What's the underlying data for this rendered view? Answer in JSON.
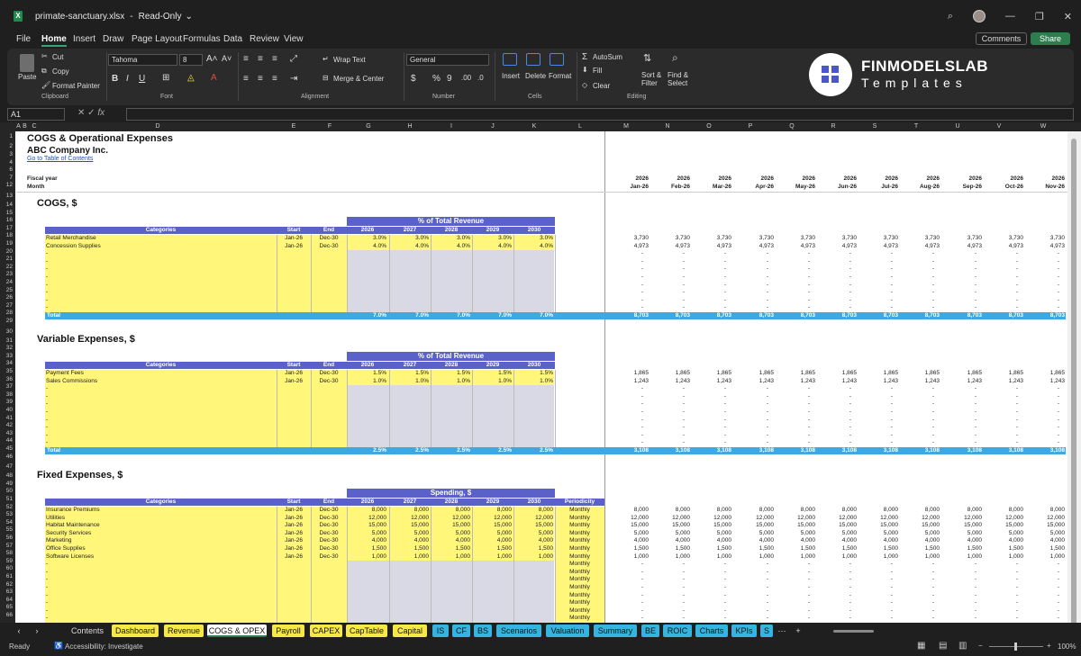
{
  "window": {
    "filename": "primate-sanctuary.xlsx",
    "mode": "Read-Only"
  },
  "menu": [
    "File",
    "Home",
    "Insert",
    "Draw",
    "Page Layout",
    "Formulas",
    "Data",
    "Review",
    "View"
  ],
  "menu_active": "Home",
  "top_buttons": {
    "comments": "Comments",
    "share": "Share"
  },
  "ribbon": {
    "clipboard": {
      "paste": "Paste",
      "cut": "Cut",
      "copy": "Copy",
      "format_painter": "Format Painter",
      "group": "Clipboard"
    },
    "font": {
      "name": "Tahoma",
      "size": "8",
      "group": "Font"
    },
    "alignment": {
      "wrap": "Wrap Text",
      "merge": "Merge & Center",
      "group": "Alignment"
    },
    "number": {
      "format": "General",
      "group": "Number"
    },
    "cells": {
      "insert": "Insert",
      "delete": "Delete",
      "format": "Format",
      "group": "Cells"
    },
    "editing": {
      "autosum": "AutoSum",
      "fill": "Fill",
      "clear": "Clear",
      "sort": "Sort &",
      "sort2": "Filter",
      "find": "Find &",
      "find2": "Select",
      "group": "Editing"
    },
    "brand": {
      "name": "FINMODELSLAB",
      "sub": "Templates"
    }
  },
  "formula_bar": {
    "name_box": "A1",
    "fx": "fx"
  },
  "col_headers": [
    "A",
    "B",
    "C",
    "D",
    "E",
    "F",
    "G",
    "H",
    "I",
    "J",
    "K",
    "L",
    "M",
    "N",
    "O",
    "P",
    "Q",
    "R",
    "S",
    "T",
    "U",
    "V",
    "W"
  ],
  "rows": [
    "1",
    "2",
    "3",
    "4",
    "6",
    "7",
    "12",
    "13",
    "14",
    "15",
    "16",
    "17",
    "18",
    "19",
    "20",
    "21",
    "22",
    "23",
    "24",
    "25",
    "26",
    "27",
    "28",
    "29",
    "30",
    "31",
    "32",
    "33",
    "34",
    "35",
    "36",
    "37",
    "38",
    "39",
    "40",
    "41",
    "42",
    "43",
    "44",
    "45",
    "46",
    "47",
    "48",
    "49",
    "50",
    "51",
    "52",
    "53",
    "54",
    "55",
    "56",
    "57",
    "58",
    "59",
    "60",
    "61",
    "62",
    "63",
    "64",
    "65",
    "66"
  ],
  "sheet": {
    "title": "COGS & Operational Expenses",
    "company": "ABC Company Inc.",
    "toc_link": "Go to Table of Contents",
    "fiscal_year_label": "Fiscal year",
    "month_label": "Month",
    "years_header": [
      "2026",
      "2026",
      "2026",
      "2026",
      "2026",
      "2026",
      "2026",
      "2026",
      "2026",
      "2026",
      "2026"
    ],
    "months_header": [
      "Jan-26",
      "Feb-26",
      "Mar-26",
      "Apr-26",
      "May-26",
      "Jun-26",
      "Jul-26",
      "Aug-26",
      "Sep-26",
      "Oct-26",
      "Nov-26"
    ],
    "col_labels": {
      "categories": "Categories",
      "start": "Start",
      "end": "End",
      "periodicity": "Periodicity"
    },
    "year_cols": [
      "2026",
      "2027",
      "2028",
      "2029",
      "2030"
    ],
    "total_label": "Total",
    "cogs": {
      "title": "COGS, $",
      "band": "% of Total Revenue",
      "items": [
        {
          "name": "Retail Merchandise",
          "start": "Jan-26",
          "end": "Dec-30",
          "pct": [
            "3.0%",
            "3.0%",
            "3.0%",
            "3.0%",
            "3.0%"
          ],
          "monthly": [
            "3,730",
            "3,730",
            "3,730",
            "3,730",
            "3,730",
            "3,730",
            "3,730",
            "3,730",
            "3,730",
            "3,730",
            "3,730"
          ]
        },
        {
          "name": "Concession Supplies",
          "start": "Jan-26",
          "end": "Dec-30",
          "pct": [
            "4.0%",
            "4.0%",
            "4.0%",
            "4.0%",
            "4.0%"
          ],
          "monthly": [
            "4,973",
            "4,973",
            "4,973",
            "4,973",
            "4,973",
            "4,973",
            "4,973",
            "4,973",
            "4,973",
            "4,973",
            "4,973"
          ]
        }
      ],
      "total_pct": [
        "7.0%",
        "7.0%",
        "7.0%",
        "7.0%",
        "7.0%"
      ],
      "total_monthly": [
        "8,703",
        "8,703",
        "8,703",
        "8,703",
        "8,703",
        "8,703",
        "8,703",
        "8,703",
        "8,703",
        "8,703",
        "8,703"
      ]
    },
    "variable": {
      "title": "Variable Expenses, $",
      "band": "% of Total Revenue",
      "items": [
        {
          "name": "Payment Fees",
          "start": "Jan-26",
          "end": "Dec-30",
          "pct": [
            "1.5%",
            "1.5%",
            "1.5%",
            "1.5%",
            "1.5%"
          ],
          "monthly": [
            "1,865",
            "1,865",
            "1,865",
            "1,865",
            "1,865",
            "1,865",
            "1,865",
            "1,865",
            "1,865",
            "1,865",
            "1,865"
          ]
        },
        {
          "name": "Sales Commissions",
          "start": "Jan-26",
          "end": "Dec-30",
          "pct": [
            "1.0%",
            "1.0%",
            "1.0%",
            "1.0%",
            "1.0%"
          ],
          "monthly": [
            "1,243",
            "1,243",
            "1,243",
            "1,243",
            "1,243",
            "1,243",
            "1,243",
            "1,243",
            "1,243",
            "1,243",
            "1,243"
          ]
        }
      ],
      "total_pct": [
        "2.5%",
        "2.5%",
        "2.5%",
        "2.5%",
        "2.5%"
      ],
      "total_monthly": [
        "3,108",
        "3,108",
        "3,108",
        "3,108",
        "3,108",
        "3,108",
        "3,108",
        "3,108",
        "3,108",
        "3,108",
        "3,108"
      ]
    },
    "fixed": {
      "title": "Fixed Expenses, $",
      "band": "Spending, $",
      "items": [
        {
          "name": "Insurance Premiums",
          "start": "Jan-26",
          "end": "Dec-30",
          "vals": [
            "8,000",
            "8,000",
            "8,000",
            "8,000",
            "8,000"
          ],
          "period": "Monthly",
          "monthly": "8,000"
        },
        {
          "name": "Utilities",
          "start": "Jan-26",
          "end": "Dec-30",
          "vals": [
            "12,000",
            "12,000",
            "12,000",
            "12,000",
            "12,000"
          ],
          "period": "Monthly",
          "monthly": "12,000"
        },
        {
          "name": "Habitat Maintenance",
          "start": "Jan-26",
          "end": "Dec-30",
          "vals": [
            "15,000",
            "15,000",
            "15,000",
            "15,000",
            "15,000"
          ],
          "period": "Monthly",
          "monthly": "15,000"
        },
        {
          "name": "Security Services",
          "start": "Jan-26",
          "end": "Dec-30",
          "vals": [
            "5,000",
            "5,000",
            "5,000",
            "5,000",
            "5,000"
          ],
          "period": "Monthly",
          "monthly": "5,000"
        },
        {
          "name": "Marketing",
          "start": "Jan-26",
          "end": "Dec-30",
          "vals": [
            "4,000",
            "4,000",
            "4,000",
            "4,000",
            "4,000"
          ],
          "period": "Monthly",
          "monthly": "4,000"
        },
        {
          "name": "Office Supplies",
          "start": "Jan-26",
          "end": "Dec-30",
          "vals": [
            "1,500",
            "1,500",
            "1,500",
            "1,500",
            "1,500"
          ],
          "period": "Monthly",
          "monthly": "1,500"
        },
        {
          "name": "Software Licenses",
          "start": "Jan-26",
          "end": "Dec-30",
          "vals": [
            "1,000",
            "1,000",
            "1,000",
            "1,000",
            "1,000"
          ],
          "period": "Monthly",
          "monthly": "1,000"
        }
      ],
      "empty_period": "Monthly"
    },
    "empty_mark": "-"
  },
  "tabs": [
    {
      "label": "Contents",
      "style": "plain"
    },
    {
      "label": "Dashboard",
      "style": "yellow"
    },
    {
      "label": "Revenue",
      "style": "yellow"
    },
    {
      "label": "COGS & OPEX",
      "style": "active"
    },
    {
      "label": "Payroll",
      "style": "yellow"
    },
    {
      "label": "CAPEX",
      "style": "yellow"
    },
    {
      "label": "CapTable",
      "style": "yellow"
    },
    {
      "label": "Capital",
      "style": "yellow"
    },
    {
      "label": "IS",
      "style": "cyan"
    },
    {
      "label": "CF",
      "style": "cyan"
    },
    {
      "label": "BS",
      "style": "cyan"
    },
    {
      "label": "Scenarios",
      "style": "cyan"
    },
    {
      "label": "Valuation",
      "style": "cyan"
    },
    {
      "label": "Summary",
      "style": "cyan"
    },
    {
      "label": "BE",
      "style": "cyan"
    },
    {
      "label": "ROIC",
      "style": "cyan"
    },
    {
      "label": "Charts",
      "style": "cyan"
    },
    {
      "label": "KPIs",
      "style": "cyan"
    },
    {
      "label": "S",
      "style": "cyan"
    }
  ],
  "status": {
    "ready": "Ready",
    "accessibility": "Accessibility: Investigate",
    "zoom": "100%"
  }
}
